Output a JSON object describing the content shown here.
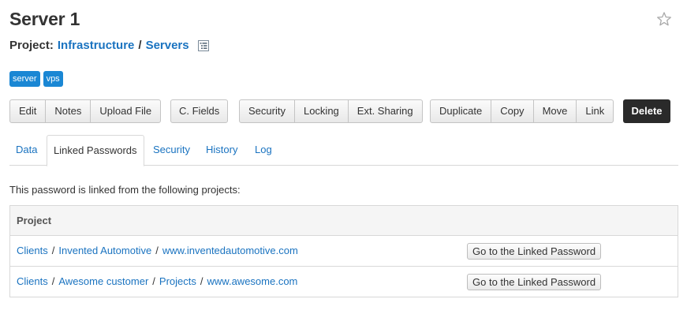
{
  "header": {
    "title": "Server 1",
    "project_label": "Project:",
    "project_path": [
      "Infrastructure",
      "Servers"
    ],
    "separator": "/"
  },
  "tags": [
    "server",
    "vps"
  ],
  "toolbar": {
    "group1": [
      "Edit",
      "Notes",
      "Upload File"
    ],
    "group2": [
      "C. Fields"
    ],
    "group3": [
      "Security",
      "Locking",
      "Ext. Sharing"
    ],
    "group4": [
      "Duplicate",
      "Copy",
      "Move",
      "Link"
    ],
    "delete_label": "Delete"
  },
  "tabs": [
    {
      "label": "Data",
      "active": false
    },
    {
      "label": "Linked Passwords",
      "active": true
    },
    {
      "label": "Security",
      "active": false
    },
    {
      "label": "History",
      "active": false
    },
    {
      "label": "Log",
      "active": false
    }
  ],
  "intro_text": "This password is linked from the following projects:",
  "table": {
    "header": "Project",
    "button_label": "Go to the Linked Password",
    "rows": [
      {
        "path": [
          "Clients",
          "Invented Automotive",
          "www.inventedautomotive.com"
        ]
      },
      {
        "path": [
          "Clients",
          "Awesome customer",
          "Projects",
          "www.awesome.com"
        ]
      }
    ]
  },
  "colors": {
    "link": "#1a73c0",
    "tag": "#1a87d4",
    "delete": "#2a2a2a"
  },
  "icons": {
    "favorite": "star-outline-icon",
    "project_tree": "tree-list-icon"
  }
}
